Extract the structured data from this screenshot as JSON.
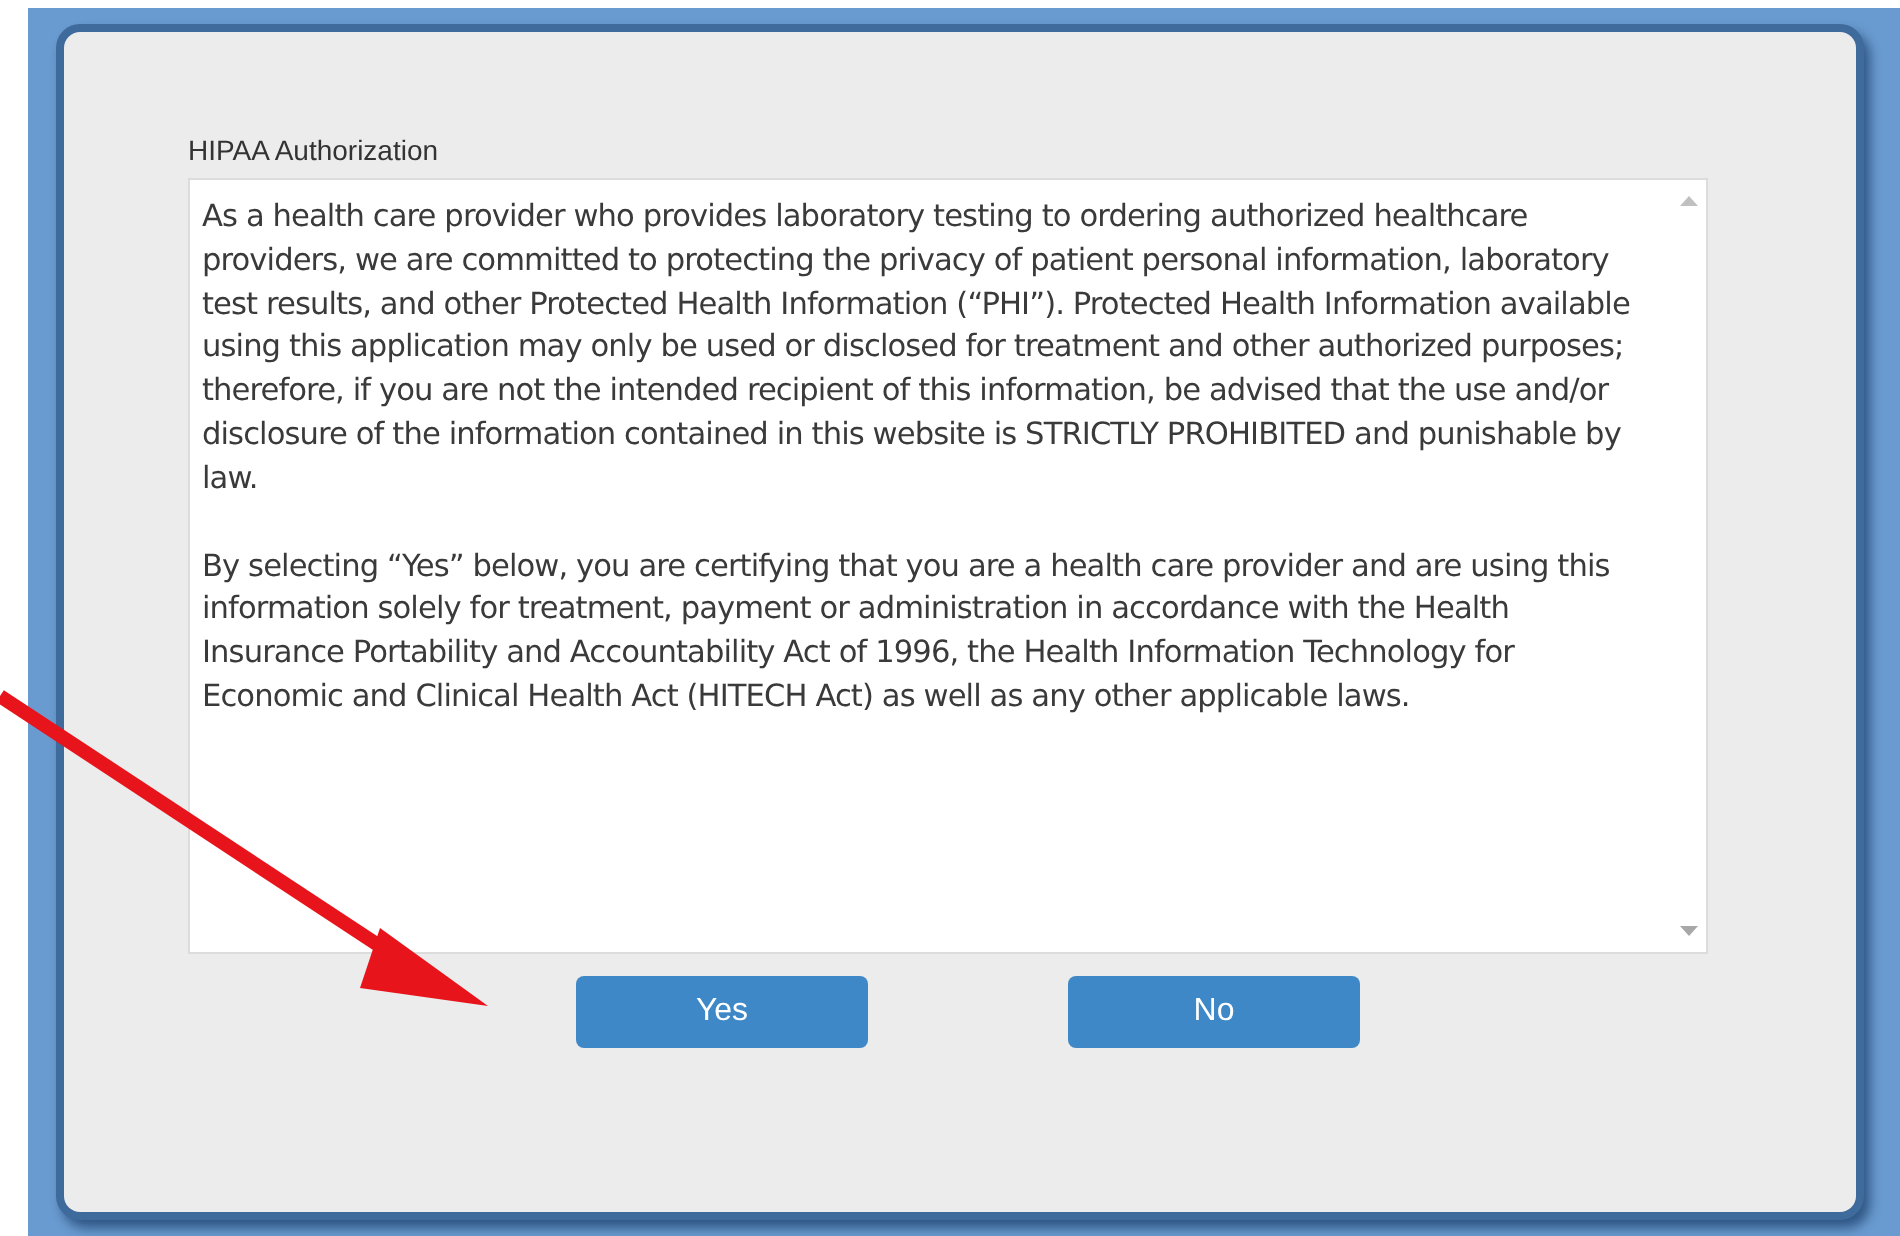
{
  "dialog": {
    "title": "HIPAA Authorization",
    "paragraphs": [
      "As a health care provider who provides laboratory testing to ordering authorized healthcare providers, we are committed to protecting the privacy of patient personal information, laboratory test results, and other Protected Health Information (“PHI”). Protected Health Information available using this application may only be used or disclosed for treatment and other authorized purposes; therefore, if you are not the intended recipient of this information, be advised that the use and/or disclosure of the information contained in this website is STRICTLY PROHIBITED and punishable by law.",
      "By selecting “Yes” below, you are certifying that you are a health care provider and are using this information solely for treatment, payment or administration in accordance with the Health Insurance Portability and Accountability Act of 1996, the Health Information Technology for Economic and Clinical Health Act (HITECH Act) as well as any other applicable laws."
    ],
    "buttons": [
      "Yes",
      "No"
    ]
  }
}
